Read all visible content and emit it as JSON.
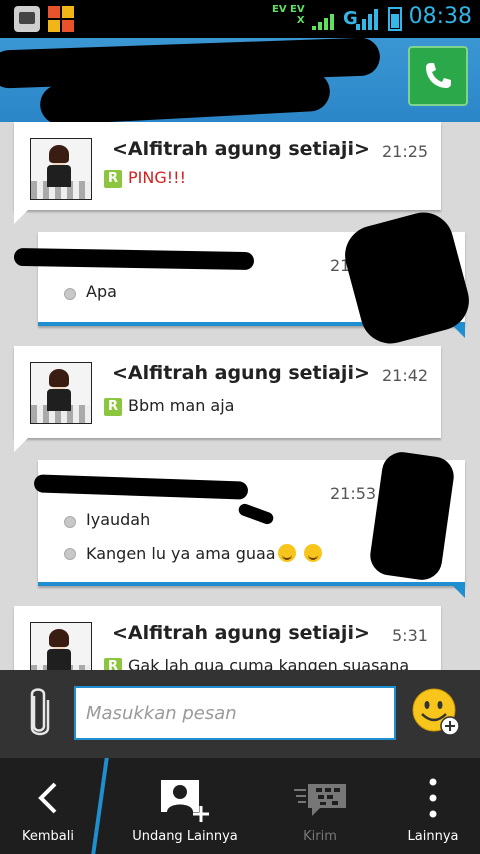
{
  "status_bar": {
    "time": "08:38",
    "network_top": "EV EV",
    "network_bottom": "X",
    "data_type": "G"
  },
  "header": {
    "contact_name": "",
    "call_icon": "phone-icon"
  },
  "messages": [
    {
      "direction": "in",
      "sender": "<Alfitrah agung setiaji>",
      "time": "21:25",
      "lines": [
        "PING!!!"
      ],
      "ping": true
    },
    {
      "direction": "out",
      "sender": "",
      "time": "21:33",
      "lines": [
        "Apa"
      ]
    },
    {
      "direction": "in",
      "sender": "<Alfitrah agung setiaji>",
      "time": "21:42",
      "lines": [
        "Bbm man aja"
      ]
    },
    {
      "direction": "out",
      "sender": "",
      "time": "21:53",
      "lines": [
        "Iyaudah",
        "Kangen lu ya ama guaa"
      ]
    },
    {
      "direction": "in",
      "sender": "<Alfitrah agung setiaji>",
      "time": "5:31",
      "lines": [
        "Gak lah gua cuma kangen suasana"
      ]
    }
  ],
  "composer": {
    "placeholder": "Masukkan pesan",
    "value": ""
  },
  "bottom_nav": {
    "back_label": "Kembali",
    "invite_label": "Undang Lainnya",
    "send_label": "Kirim",
    "more_label": "Lainnya"
  },
  "colors": {
    "accent": "#1f8fd0",
    "header": "#3b97d3",
    "ping": "#d61f1f",
    "r_badge": "#8cc63f"
  }
}
